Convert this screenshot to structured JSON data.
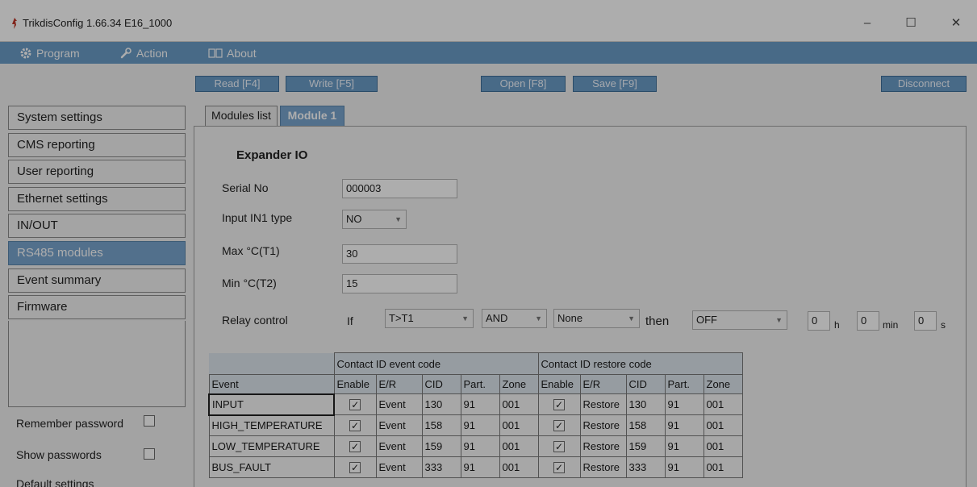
{
  "window": {
    "title": "TrikdisConfig 1.66.34   E16_1000",
    "minimize_glyph": "–",
    "maximize_glyph": "☐",
    "close_glyph": "✕"
  },
  "menu": {
    "program": "Program",
    "action": "Action",
    "about": "About"
  },
  "toolbar": {
    "read": "Read [F4]",
    "write": "Write [F5]",
    "open": "Open [F8]",
    "save": "Save [F9]",
    "disconnect": "Disconnect"
  },
  "sidebar": {
    "items": [
      "System settings",
      "CMS reporting",
      "User reporting",
      "Ethernet settings",
      "IN/OUT",
      "RS485 modules",
      "Event summary",
      "Firmware"
    ],
    "active_index": 5,
    "remember_password": "Remember password",
    "show_passwords": "Show passwords",
    "default_settings": "Default settings"
  },
  "tabs": {
    "modules_list": "Modules list",
    "module1": "Module 1"
  },
  "form": {
    "title": "Expander IO",
    "serial_label": "Serial No",
    "serial_value": "000003",
    "input_type_label": "Input IN1 type",
    "input_type_value": "NO",
    "max_label": "Max °C(T1)",
    "max_value": "30",
    "min_label": "Min °C(T2)",
    "min_value": "15",
    "relay_label": "Relay control",
    "if_label": "If",
    "cond1": "T>T1",
    "logic": "AND",
    "cond2": "None",
    "then_label": "then",
    "action": "OFF",
    "h_value": "0",
    "h_unit": "h",
    "min_value_t": "0",
    "min_unit": "min",
    "s_value": "0",
    "s_unit": "s"
  },
  "table": {
    "group_event": "Contact ID event code",
    "group_restore": "Contact ID restore code",
    "headers": [
      "Event",
      "Enable",
      "E/R",
      "CID",
      "Part.",
      "Zone",
      "Enable",
      "E/R",
      "CID",
      "Part.",
      "Zone"
    ],
    "check_glyph": "✓",
    "rows": [
      {
        "event": "INPUT",
        "er": "Event",
        "cid": "130",
        "part": "91",
        "zone": "001",
        "rer": "Restore",
        "rcid": "130",
        "rpart": "91",
        "rzone": "001"
      },
      {
        "event": "HIGH_TEMPERATURE",
        "er": "Event",
        "cid": "158",
        "part": "91",
        "zone": "001",
        "rer": "Restore",
        "rcid": "158",
        "rpart": "91",
        "rzone": "001"
      },
      {
        "event": "LOW_TEMPERATURE",
        "er": "Event",
        "cid": "159",
        "part": "91",
        "zone": "001",
        "rer": "Restore",
        "rcid": "159",
        "rpart": "91",
        "rzone": "001"
      },
      {
        "event": "BUS_FAULT",
        "er": "Event",
        "cid": "333",
        "part": "91",
        "zone": "001",
        "rer": "Restore",
        "rcid": "333",
        "rpart": "91",
        "rzone": "001"
      }
    ]
  },
  "colors": {
    "accent": "#6a9cc8",
    "active": "#7aa6cf",
    "app_icon": "#c0392b"
  }
}
